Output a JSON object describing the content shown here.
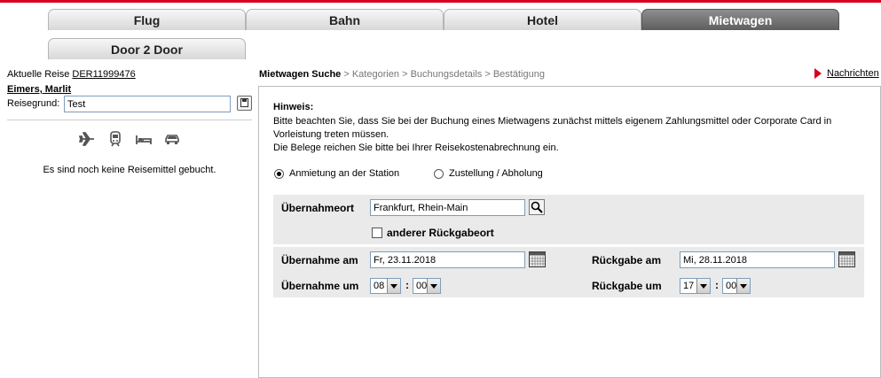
{
  "tabs": [
    {
      "label": "Flug"
    },
    {
      "label": "Bahn"
    },
    {
      "label": "Hotel"
    },
    {
      "label": "Mietwagen"
    },
    {
      "label": "Door 2 Door"
    }
  ],
  "active_tab": "Mietwagen",
  "sidebar": {
    "trip_label": "Aktuelle Reise",
    "trip_id": "DER11999476",
    "traveler": "Eimers, Marlit",
    "reason_label": "Reisegrund:",
    "reason_value": "Test",
    "mode_icons": [
      "plane-icon",
      "train-icon",
      "hotel-bed-icon",
      "car-icon"
    ],
    "no_booking_text": "Es sind noch keine Reisemittel gebucht."
  },
  "breadcrumb": {
    "current": "Mietwagen Suche",
    "rest": " > Kategorien > Buchungsdetails > Bestätigung"
  },
  "news_link": "Nachrichten",
  "hint": {
    "title": "Hinweis:",
    "line1": "Bitte beachten Sie, dass Sie bei der Buchung eines Mietwagens zunächst mittels eigenem Zahlungsmittel oder Corporate Card in Vorleistung treten müssen.",
    "line2": "Die Belege reichen Sie bitte bei Ihrer Reisekostenabrechnung ein."
  },
  "options": {
    "station": "Anmietung an der Station",
    "delivery": "Zustellung / Abholung",
    "selected": "station"
  },
  "form": {
    "pickup_place_label": "Übernahmeort",
    "pickup_place_value": "Frankfurt, Rhein-Main",
    "other_return_label": "anderer Rückgabeort",
    "pickup_date_label": "Übernahme am",
    "pickup_date_value": "Fr, 23.11.2018",
    "return_date_label": "Rückgabe am",
    "return_date_value": "Mi, 28.11.2018",
    "pickup_time_label": "Übernahme um",
    "pickup_hour": "08",
    "pickup_min": "00",
    "return_time_label": "Rückgabe um",
    "return_hour": "17",
    "return_min": "00",
    "colon": ":"
  }
}
